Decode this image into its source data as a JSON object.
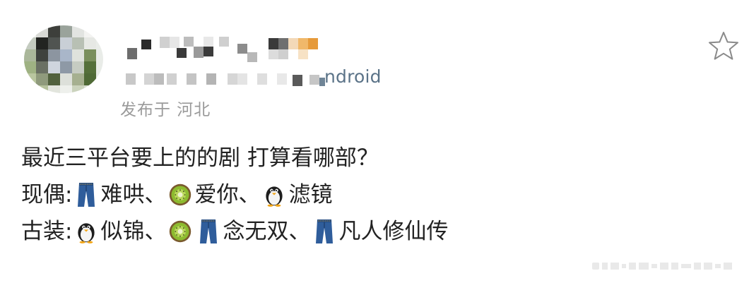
{
  "post": {
    "source_suffix": "ndroid",
    "location": "发布于 河北",
    "text": {
      "line1": "最近三平台要上的的剧 打算看哪部？",
      "line2": {
        "label": "现偶:",
        "item1": "难哄、",
        "item2": "爱你、",
        "item3": "滤镜"
      },
      "line3": {
        "label": "古装:",
        "item1": "似锦、",
        "item2": "念无双、",
        "item3": "凡人修仙传"
      }
    }
  },
  "icons": {
    "favorite": "star-outline-icon",
    "jeans": "jeans-emoji",
    "kiwi": "kiwi-emoji",
    "penguin": "penguin-emoji"
  },
  "colors": {
    "source_text": "#5b7388",
    "location_text": "#9a9a9a",
    "body_text": "#222222"
  }
}
